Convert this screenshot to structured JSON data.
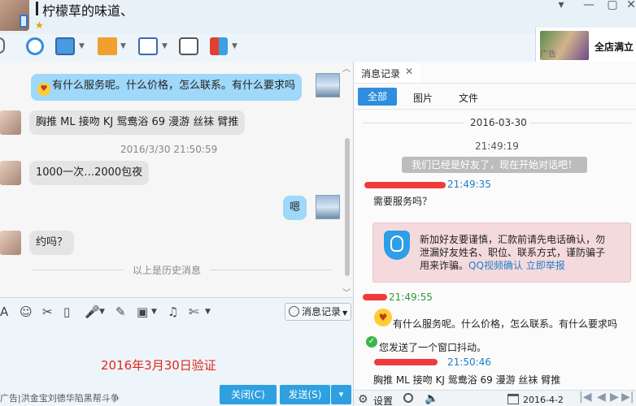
{
  "window": {
    "title": "柠檬草的味道、",
    "star": "★",
    "controls": {
      "dropdown": "▾",
      "minimize": "—",
      "maximize": "▢",
      "close": "✕"
    }
  },
  "ad_banner": {
    "label": "广告",
    "text": "全店满立"
  },
  "chat": {
    "messages": [
      {
        "dir": "out",
        "emoji": "😍",
        "text": "有什么服务呢。什么价格，怎么联系。有什么要求吗"
      },
      {
        "dir": "in",
        "text": "胸推 ML  接吻 KJ 鸳鸯浴 69 漫游   丝袜  臂推"
      },
      {
        "dir": "ts",
        "text": "2016/3/30 21:50:59"
      },
      {
        "dir": "in",
        "text": "1000一次…2000包夜"
      },
      {
        "dir": "out",
        "text": "嗯"
      },
      {
        "dir": "in",
        "text": "约吗？"
      }
    ],
    "history_divider": "以上是历史消息"
  },
  "input_toolbar": {
    "icons": [
      "A",
      "☺",
      "✂",
      "▯",
      "🎤",
      "✎",
      "▣",
      "♫",
      "✄"
    ],
    "message_record_label": "消息记录"
  },
  "input": {
    "text": "2016年3月30日验证"
  },
  "bottom": {
    "ad_link": "广告|洪金宝刘德华陷黑帮斗争",
    "close_label": "关闭(C)",
    "send_label": "发送(S)",
    "send_dropdown": "▾"
  },
  "right_panel": {
    "tab_label": "消息记录",
    "tab_close": "✕",
    "filters": [
      "全部",
      "图片",
      "文件"
    ],
    "date_header": "2016-03-30",
    "time_header": "21:49:19",
    "friend_banner": "我们已经是好友了，现在开始对话吧！",
    "entries": {
      "t1": "21:49:35",
      "m1": "需要服务吗？",
      "warning_text": "新加好友要谨慎，汇款前请先电话确认，勿泄漏好友姓名、职位、联系方式，谨防骗子用来诈骗。",
      "warning_link": "QQ视频确认 立即举报",
      "t2": "21:49:55",
      "m2": "有什么服务呢。什么价格，怎么联系。有什么要求吗",
      "m3": "您发送了一个窗口抖动。",
      "t3": "21:50:46",
      "m4": "胸推 ML  接吻 KJ 鸳鸯浴 69 漫游   丝袜  臂推"
    },
    "bottom": {
      "settings_label": "设置",
      "date": "2016-4-2",
      "nav": [
        "|◀",
        "◀",
        "▶",
        "▶|"
      ]
    }
  },
  "colors": {
    "accent_blue": "#2ea0e0",
    "bubble_out": "#9fd8f8",
    "bubble_in": "#e4e4e4",
    "redaction_red": "#ee2a2a",
    "warning_bg": "#f5dadd",
    "input_text_red": "#e0261a"
  }
}
